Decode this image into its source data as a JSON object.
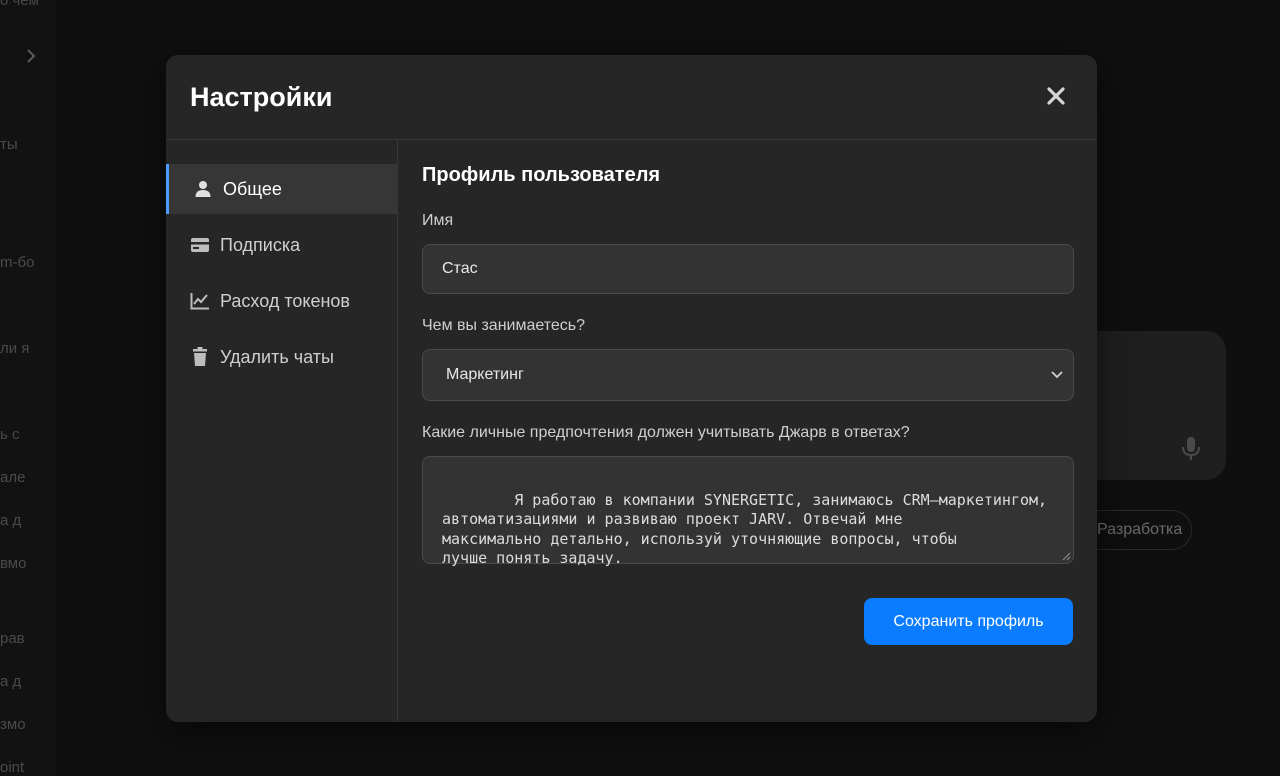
{
  "background": {
    "sidebar_fragments": [
      "о чем",
      "ты",
      "m-бо",
      "ли я",
      "ь с",
      "але",
      "а д",
      "вмо",
      "рав",
      "а д",
      "змо",
      "oint"
    ],
    "chip_label": "Разработка"
  },
  "modal": {
    "title": "Настройки",
    "close_icon": "close-icon"
  },
  "nav": {
    "items": [
      {
        "label": "Общее",
        "icon": "user-icon",
        "active": true
      },
      {
        "label": "Подписка",
        "icon": "credit-card-icon",
        "active": false
      },
      {
        "label": "Расход токенов",
        "icon": "chart-line-icon",
        "active": false
      },
      {
        "label": "Удалить чаты",
        "icon": "trash-icon",
        "active": false
      }
    ]
  },
  "profile": {
    "section_title": "Профиль пользователя",
    "name_label": "Имя",
    "name_value": "Стас",
    "occupation_label": "Чем вы занимаетесь?",
    "occupation_value": "Маркетинг",
    "preferences_label": "Какие личные предпочтения должен учитывать Джарв в ответах?",
    "preferences_value": "Я работаю в компании SYNERGETIC, занимаюсь CRM–маркетингом,\nавтоматизациями и развиваю проект JARV. Отвечай мне\nмаксимально детально, используй уточняющие вопросы, чтобы\nлучше понять задачу.",
    "save_label": "Сохранить профиль"
  },
  "colors": {
    "accent": "#0a7cff",
    "active_indicator": "#4a9dff",
    "modal_bg": "#262627"
  }
}
